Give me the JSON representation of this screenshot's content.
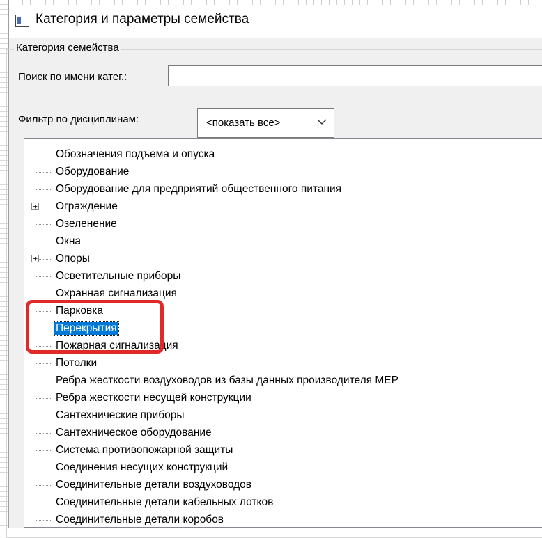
{
  "window": {
    "title": "Категория и параметры семейства"
  },
  "category_group": {
    "legend": "Категория семейства",
    "search_label": "Поиск по имени катег.:",
    "search_value": "",
    "filter_label": "Фильтр по дисциплинам:",
    "filter_selected": "<показать все>"
  },
  "tree": {
    "items": [
      {
        "label": "Обозначения подъема и опуска",
        "expandable": false,
        "selected": false
      },
      {
        "label": "Оборудование",
        "expandable": false,
        "selected": false
      },
      {
        "label": "Оборудование для предприятий общественного питания",
        "expandable": false,
        "selected": false
      },
      {
        "label": "Ограждение",
        "expandable": true,
        "selected": false
      },
      {
        "label": "Озеленение",
        "expandable": false,
        "selected": false
      },
      {
        "label": "Окна",
        "expandable": false,
        "selected": false
      },
      {
        "label": "Опоры",
        "expandable": true,
        "selected": false
      },
      {
        "label": "Осветительные приборы",
        "expandable": false,
        "selected": false
      },
      {
        "label": "Охранная сигнализация",
        "expandable": false,
        "selected": false
      },
      {
        "label": "Парковка",
        "expandable": false,
        "selected": false
      },
      {
        "label": "Перекрытия",
        "expandable": false,
        "selected": true
      },
      {
        "label": "Пожарная сигнализация",
        "expandable": false,
        "selected": false
      },
      {
        "label": "Потолки",
        "expandable": false,
        "selected": false
      },
      {
        "label": "Ребра жесткости воздуховодов из базы данных производителя MEP",
        "expandable": false,
        "selected": false
      },
      {
        "label": "Ребра жесткости несущей конструкции",
        "expandable": false,
        "selected": false
      },
      {
        "label": "Сантехнические приборы",
        "expandable": false,
        "selected": false
      },
      {
        "label": "Сантехническое оборудование",
        "expandable": false,
        "selected": false
      },
      {
        "label": "Система противопожарной защиты",
        "expandable": false,
        "selected": false
      },
      {
        "label": "Соединения несущих конструкций",
        "expandable": false,
        "selected": false
      },
      {
        "label": "Соединительные детали воздуховодов",
        "expandable": false,
        "selected": false
      },
      {
        "label": "Соединительные детали кабельных лотков",
        "expandable": false,
        "selected": false
      },
      {
        "label": "Соединительные детали коробов",
        "expandable": false,
        "selected": false
      }
    ],
    "expander_symbol": "+"
  },
  "annotation": {
    "color": "#e02a2a"
  },
  "colors": {
    "selection": "#0078d7",
    "dialog_bg": "#f0f0f0"
  }
}
